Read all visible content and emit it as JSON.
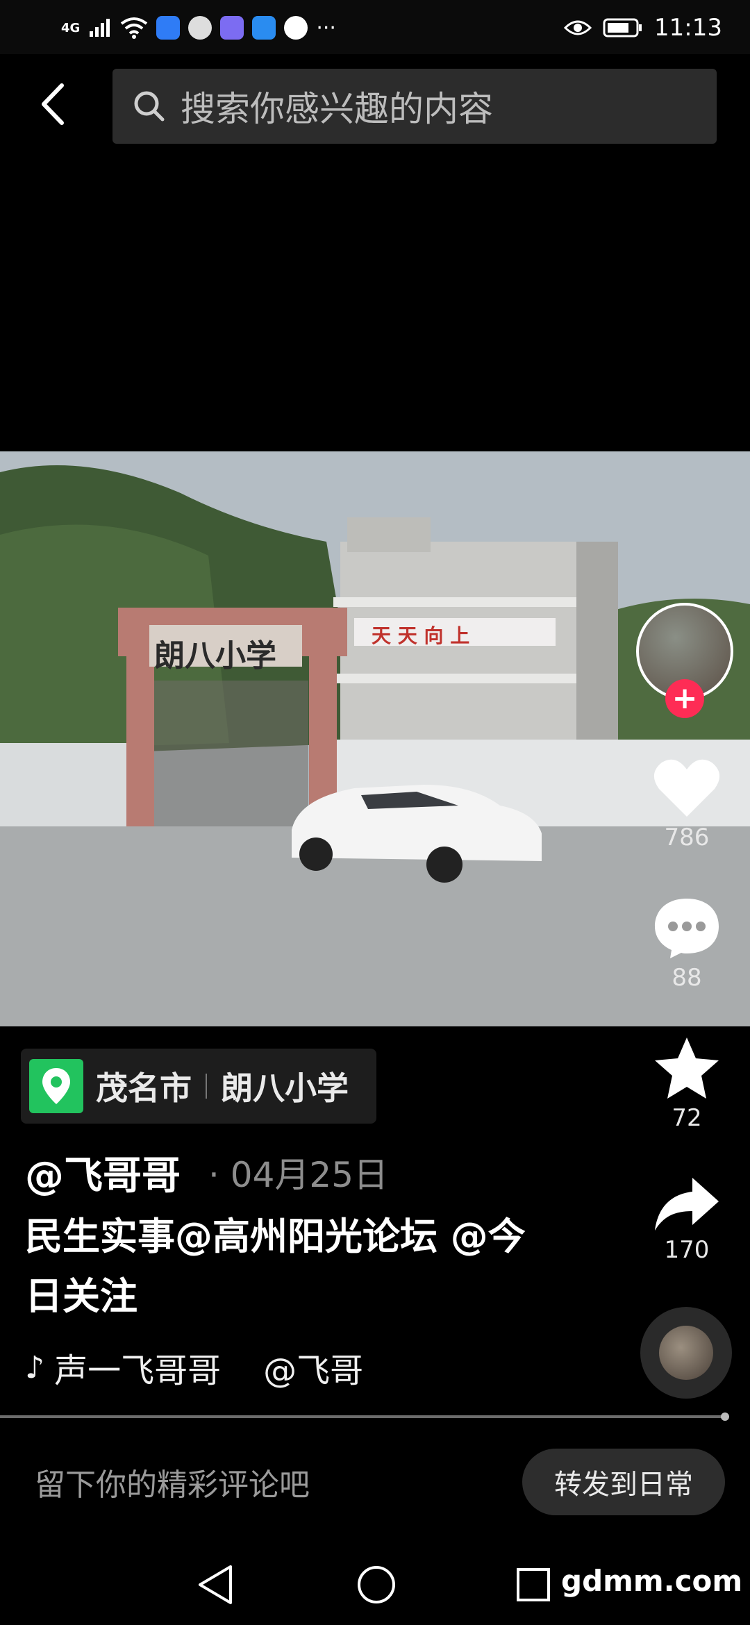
{
  "status_bar": {
    "network": "4G",
    "time": "11:13",
    "more": "···"
  },
  "search": {
    "placeholder": "搜索你感兴趣的内容"
  },
  "video": {
    "gate_sign": "朗八小学",
    "building_banner": "天 天 向 上"
  },
  "rail": {
    "likes": "786",
    "comments": "88",
    "favorites": "72",
    "shares": "170",
    "follow_symbol": "+"
  },
  "location": {
    "city": "茂名市",
    "place": "朗八小学"
  },
  "post": {
    "author": "@飞哥哥",
    "date": "· 04月25日",
    "caption": "民生实事@高州阳光论坛 @今日关注",
    "music": "声一飞哥哥    @飞哥"
  },
  "bottom": {
    "comment_placeholder": "留下你的精彩评论吧",
    "forward_label": "转发到日常"
  },
  "watermark": "gdmm.com"
}
